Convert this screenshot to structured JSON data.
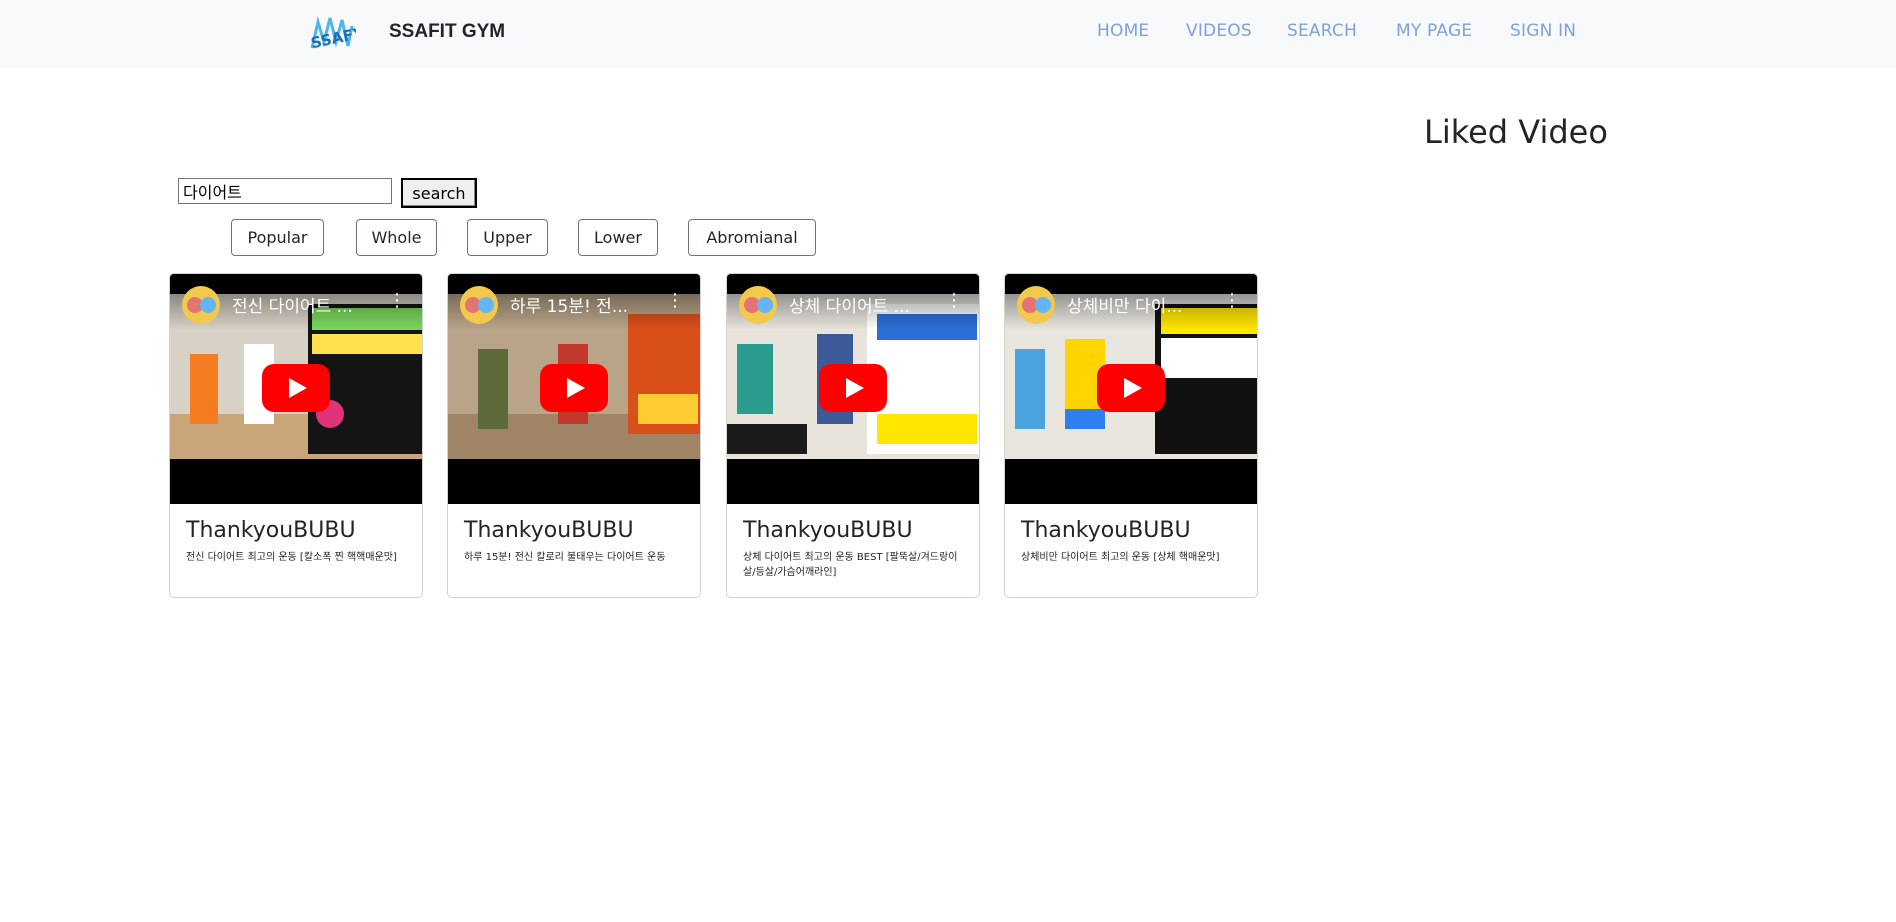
{
  "navbar": {
    "brand": "SSAFIT GYM",
    "logo_text": "SSAFY",
    "links": [
      "HOME",
      "VIDEOS",
      "SEARCH",
      "MY PAGE",
      "SIGN IN"
    ]
  },
  "liked": {
    "title": "Liked Video"
  },
  "search": {
    "value": "다이어트",
    "button_label": "search"
  },
  "categories": [
    "Popular",
    "Whole",
    "Upper",
    "Lower",
    "Abromianal"
  ],
  "videos": [
    {
      "video_title": "전신 다이어트 ...",
      "channel": "ThankyouBUBU",
      "description": "전신 다이어트 최고의 운동 [칼소폭 찐 핵핵매운맛]"
    },
    {
      "video_title": "하루 15분! 전...",
      "channel": "ThankyouBUBU",
      "description": "하루 15분! 전신 칼로리 불태우는 다이어트 운동"
    },
    {
      "video_title": "상체 다이어트 ...",
      "channel": "ThankyouBUBU",
      "description": "상체 다이어트 최고의 운동 BEST [팔뚝살/겨드랑이살/등살/가슴어깨라인]"
    },
    {
      "video_title": "상체비만 다이...",
      "channel": "ThankyouBUBU",
      "description": "상체비만 다이어트 최고의 운동 [상체 핵매운맛]"
    }
  ],
  "colors": {
    "nav_link": "#7ea1dd",
    "navbar_bg": "#f8f9fa",
    "play_red": "#ff0000"
  }
}
